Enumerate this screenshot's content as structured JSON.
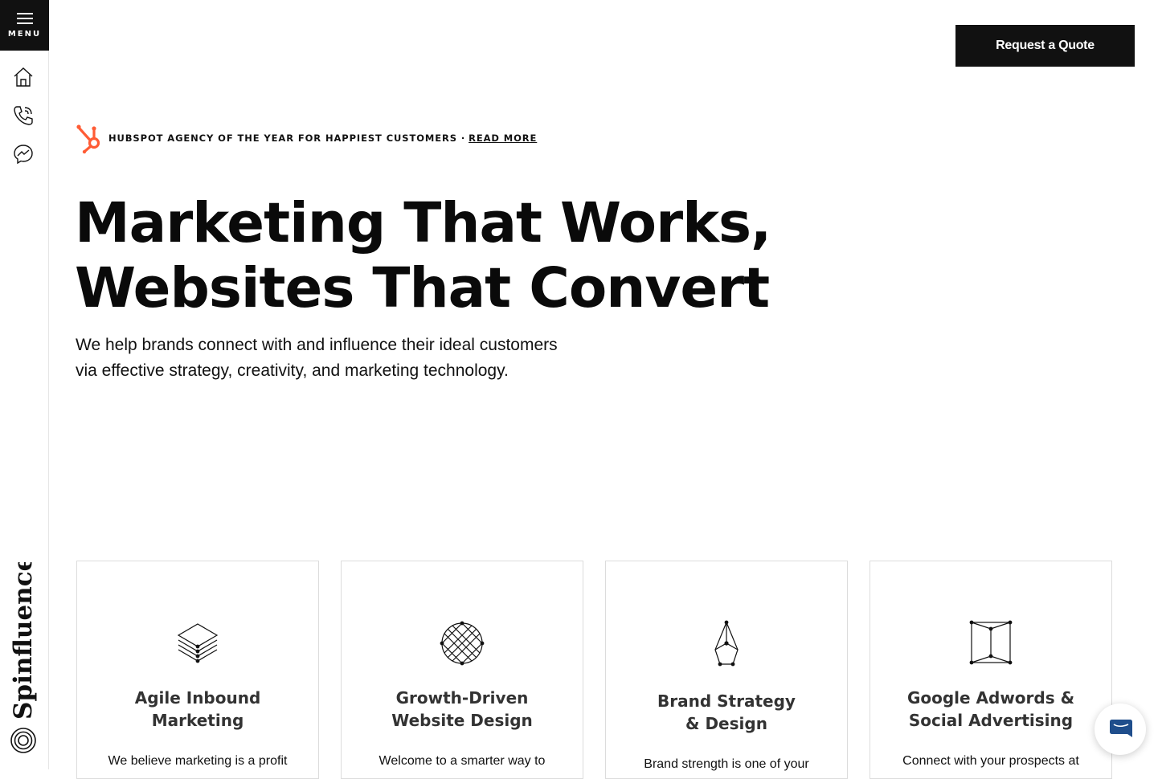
{
  "rail": {
    "menu_label": "MENU",
    "icons": [
      "home-icon",
      "phone-icon",
      "messenger-icon"
    ],
    "logo_text": "Spinfluence"
  },
  "header": {
    "quote_label": "Request a Quote"
  },
  "award": {
    "text": "HUBSPOT AGENCY OF THE YEAR FOR HAPPIEST CUSTOMERS · ",
    "link": "READ MORE",
    "accent": "#ff5c35"
  },
  "hero": {
    "line1": "Marketing That Works,",
    "line2": "Websites That Convert",
    "lead_line1": "We help brands connect with and influence their ideal customers",
    "lead_line2": "via effective strategy, creativity, and marketing technology."
  },
  "cards": [
    {
      "title1": "Agile Inbound",
      "title2": "Marketing",
      "body": "We believe marketing is a profit",
      "icon": "layers-icon"
    },
    {
      "title1": "Growth-Driven",
      "title2": "Website Design",
      "body": "Welcome to a smarter way to",
      "icon": "globe-grid-icon"
    },
    {
      "title1": "Brand Strategy",
      "title2": "& Design",
      "body": "Brand strength is one of your",
      "icon": "pen-nib-icon"
    },
    {
      "title1": "Google Adwords &",
      "title2": "Social Advertising",
      "body": "Connect with your prospects at",
      "icon": "open-box-icon"
    }
  ],
  "colors": {
    "dark": "#111111",
    "chat_blue": "#1f4e8c"
  }
}
